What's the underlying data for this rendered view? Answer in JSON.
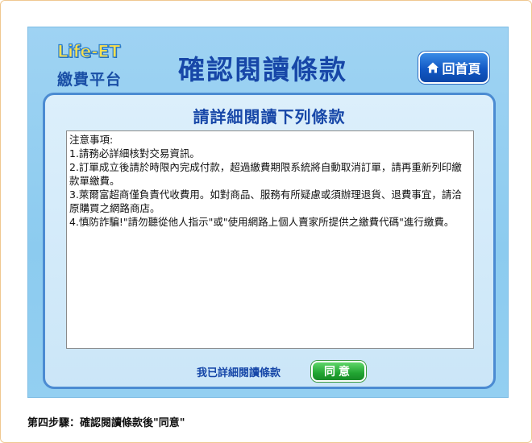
{
  "header": {
    "logo_text": "Life-ET",
    "logo_subtitle": "繳費平台",
    "title": "確認閱讀條款",
    "home_button": "回首頁",
    "home_icon": "home-icon"
  },
  "panel": {
    "title": "請詳細閱讀下列條款",
    "terms": [
      "注意事項:",
      "1.請務必詳細核對交易資訊。",
      "2.訂單成立後請於時限內完成付款，超過繳費期限系統將自動取消訂單，請再重新列印繳款單繳費。",
      "3.萊爾富超商僅負責代收費用。如對商品、服務有所疑慮或須辦理退貨、退費事宜，請洽原購買之網路商店。",
      "4.慎防詐騙!\"請勿聽從他人指示\"或\"使用網路上個人賣家所提供之繳費代碼\"進行繳費。"
    ],
    "agree_label": "我已詳細閱讀條款",
    "agree_button": "同意"
  },
  "caption": "第四步驟：確認閱讀條款後\"同意\"",
  "colors": {
    "title_blue": "#1747a8",
    "screen_bg": "#9fd3f3",
    "home_button": "#1258c4",
    "agree_button": "#22a532"
  }
}
